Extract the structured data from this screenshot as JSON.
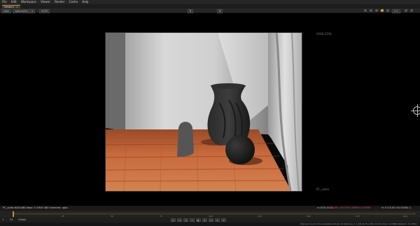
{
  "menubar": {
    "items": [
      "File",
      "Edit",
      "Workspace",
      "Viewer",
      "Render",
      "Cache",
      "Help"
    ]
  },
  "tabs": [
    {
      "label": "Viewer1"
    }
  ],
  "toolbar": {
    "channels": "rgba",
    "layer": "rgba.alpha",
    "compare": "A",
    "input": "ACES",
    "wipe": "B",
    "zoom": "1:1"
  },
  "viewer": {
    "plate_label": "PC_video",
    "bbox_top": "2048,1556"
  },
  "infobar": {
    "left": "PC_video 640x480 bbox: 0 0 640 480 channels: rgba",
    "coords": "x=528 y=11",
    "values": "0.54198 0.51729 0.40000 1.00000",
    "hsv": "H: 0 S:0.00 V:0.50000 L: 0.00000"
  },
  "timeline": {
    "ticks": [
      "1",
      "25",
      "50",
      "75",
      "100",
      "125",
      "150",
      "175",
      "200"
    ],
    "current_frame": "1"
  },
  "controls": {
    "frame": "1",
    "fps": "24",
    "mode": "Global",
    "buttons": [
      "|<",
      "<<",
      "<|",
      "<",
      "▶",
      "|>",
      ">>",
      ">|",
      "⟳"
    ]
  },
  "status": {
    "text": "Channel Count: 25  Localization Mode: On  Memory: 1.1 GB (6.7%)  CPU: 14.0%  Disk: 0.2 MB/s  Network: 0.0 MB/s"
  },
  "colors": {
    "accent": "#e08a2a",
    "background": "#000000",
    "panel": "#262626"
  }
}
